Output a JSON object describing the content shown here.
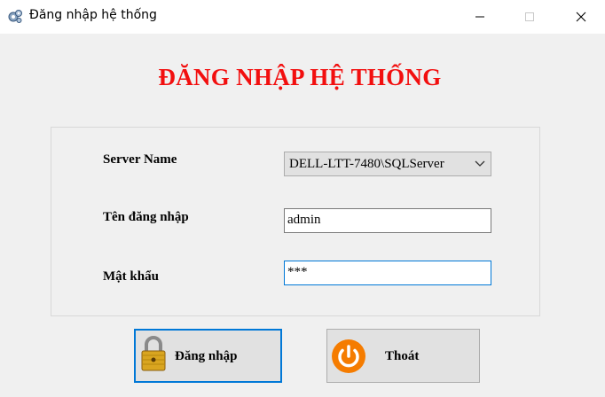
{
  "window": {
    "title": "Đăng nhập hệ thống",
    "controls": [
      "minimize",
      "maximize",
      "close"
    ]
  },
  "heading": "ĐĂNG NHẬP HỆ THỐNG",
  "form": {
    "server_label": "Server Name",
    "server_value": "DELL-LTT-7480\\SQLServer",
    "username_label": "Tên đăng nhập",
    "username_value": "admin",
    "password_label": "Mật khẩu",
    "password_value": "***"
  },
  "buttons": {
    "login": {
      "label": "Đăng nhập",
      "icon": "padlock-icon"
    },
    "exit": {
      "label": "Thoát",
      "icon": "power-icon"
    }
  },
  "colors": {
    "heading": "#f20f0f",
    "focus_border": "#0078d7",
    "power_icon": "#f57c00"
  }
}
